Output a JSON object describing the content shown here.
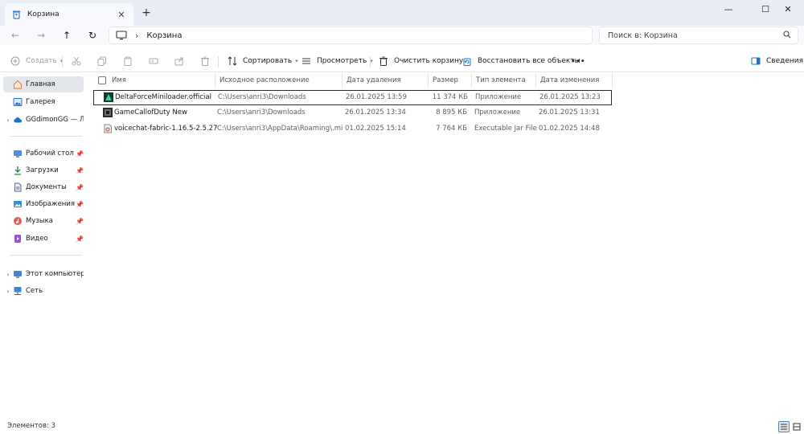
{
  "window": {
    "tab_title": "Корзина",
    "new_tab": "+",
    "tab_close": "✕",
    "minimize": "—",
    "maximize": "☐",
    "close": "✕"
  },
  "nav": {
    "back": "←",
    "forward": "→",
    "up": "↑",
    "refresh": "↻",
    "breadcrumb_sep": "›",
    "breadcrumb": "Корзина",
    "search_placeholder": "Поиск в: Корзина"
  },
  "toolbar": {
    "create": "Создать",
    "sort": "Сортировать",
    "view": "Просмотреть",
    "empty_bin": "Очистить корзину",
    "restore_all": "Восстановить все объекты",
    "more": "•••",
    "details": "Сведения"
  },
  "sidebar": {
    "items": [
      {
        "label": "Главная",
        "icon": "home-icon"
      },
      {
        "label": "Галерея",
        "icon": "gallery-icon"
      },
      {
        "label": "GGdimonGG — Ли",
        "icon": "cloud-icon"
      },
      {
        "label": "Рабочий стол",
        "icon": "desktop-icon"
      },
      {
        "label": "Загрузки",
        "icon": "download-icon"
      },
      {
        "label": "Документы",
        "icon": "documents-icon"
      },
      {
        "label": "Изображения",
        "icon": "pictures-icon"
      },
      {
        "label": "Музыка",
        "icon": "music-icon"
      },
      {
        "label": "Видео",
        "icon": "video-icon"
      },
      {
        "label": "Этот компьютер",
        "icon": "computer-icon"
      },
      {
        "label": "Сеть",
        "icon": "network-icon"
      }
    ],
    "pin": "📌",
    "chevron": "›"
  },
  "table": {
    "columns": [
      "Имя",
      "Исходное расположение",
      "Дата удаления",
      "Размер",
      "Тип элемента",
      "Дата изменения"
    ],
    "rows": [
      {
        "name": "DeltaForceMiniloader.official",
        "location": "C:\\Users\\anri3\\Downloads",
        "deleted": "26.01.2025 13:59",
        "size": "11 374 КБ",
        "type": "Приложение",
        "modified": "26.01.2025 13:23"
      },
      {
        "name": "GameCallofDuty New",
        "location": "C:\\Users\\anri3\\Downloads",
        "deleted": "26.01.2025 13:34",
        "size": "8 895 КБ",
        "type": "Приложение",
        "modified": "26.01.2025 13:31"
      },
      {
        "name": "voicechat-fabric-1.16.5-2.5.27",
        "location": "C:\\Users\\anri3\\AppData\\Roaming\\.minec...",
        "deleted": "01.02.2025 15:14",
        "size": "7 764 КБ",
        "type": "Executable Jar File",
        "modified": "01.02.2025 14:48"
      }
    ]
  },
  "status": {
    "items_count": "Элементов: 3"
  },
  "colors": {
    "accent": "#1a73c8",
    "selected_bg": "#e3e6ea",
    "titlebar_bg": "#e9eef6"
  }
}
